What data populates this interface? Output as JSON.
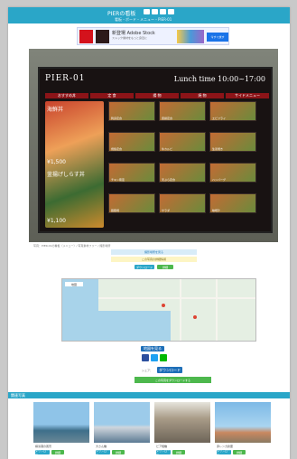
{
  "header": {
    "title": "PIERの看板",
    "subtitle": "看板・ボード・メニュー・PIER-01"
  },
  "ad": {
    "title": "新登場 Adobe Stock",
    "copy": "ストック素材をもっと身近に",
    "cta": "今すぐ試す"
  },
  "menu_board": {
    "brand": "PIER-01",
    "lunch": "Lunch time 10:00~17:00",
    "categories": [
      "おすすめ丼",
      "定 食",
      "揚 物",
      "焼 物",
      "サイドメニュー"
    ],
    "dishes": [
      {
        "name": "海鮮丼",
        "price": "¥1,500"
      },
      {
        "name": "釜揚げしらす丼",
        "price": "¥1,100"
      }
    ],
    "tiles": [
      "刺身定食",
      "唐揚定食",
      "エビフライ",
      "焼魚定食",
      "牛カルビ",
      "生姜焼き",
      "チキン南蛮",
      "天ぷら定食",
      "ハンバーグ",
      "鶏照焼",
      "サラダ",
      "味噌汁"
    ]
  },
  "caption": "写真：PIER-01の看板（メニュー）/ 写真素材フリー / 撮影場所",
  "links": {
    "blue_bar": "撮影場所を見る",
    "yellow_bar": "この写真の詳細情報"
  },
  "pills": {
    "a": "ダウンロード",
    "b": "詳細"
  },
  "map": {
    "type_label": "地図"
  },
  "buttons": {
    "map_button": "地図を見る",
    "more_button": "ダウンロード",
    "wide_green": "この写真をダウンロードする"
  },
  "share": {
    "label": "シェア："
  },
  "related": {
    "section_title": "関連写真",
    "cards": [
      "横浜港の風景",
      "大さん橋",
      "ピア桟橋",
      "赤レンガ倉庫"
    ]
  },
  "colors": {
    "accent": "#2aa6c8",
    "green": "#4db84d",
    "blue": "#1e6fb8"
  }
}
